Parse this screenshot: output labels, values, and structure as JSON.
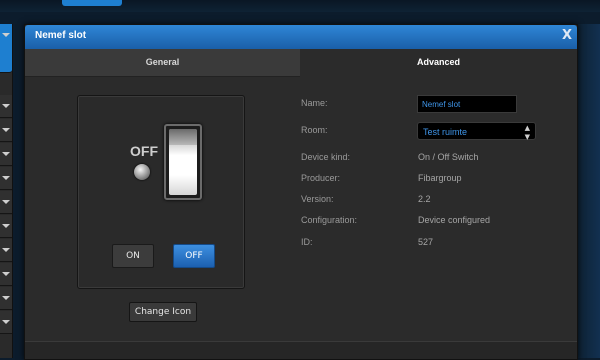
{
  "dialog": {
    "title": "Nemef slot",
    "close_glyph": "X"
  },
  "tabs": [
    {
      "label": "General"
    },
    {
      "label": "Advanced"
    }
  ],
  "icon_panel": {
    "state_label": "OFF",
    "on_button": "ON",
    "off_button": "OFF",
    "change_icon_button": "Change Icon"
  },
  "properties": {
    "name_label": "Name:",
    "name_value": "Nemef slot",
    "room_label": "Room:",
    "room_value": "Test ruimte",
    "device_kind_label": "Device kind:",
    "device_kind_value": "On / Off Switch",
    "producer_label": "Producer:",
    "producer_value": "Fibargroup",
    "version_label": "Version:",
    "version_value": "2.2",
    "configuration_label": "Configuration:",
    "configuration_value": "Device configured",
    "id_label": "ID:",
    "id_value": "527"
  },
  "colors": {
    "accent": "#1e7fd0",
    "value_link": "#3f95e8",
    "dialog_bg": "#2b2b2b"
  }
}
